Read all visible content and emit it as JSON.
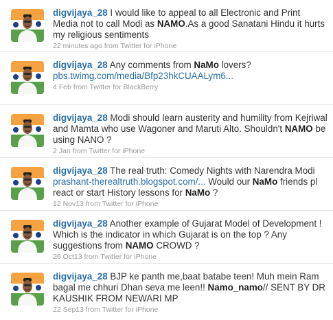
{
  "colors": {
    "link": "#2a6fa8",
    "text": "#333333",
    "meta": "#999999",
    "divider": "#e6e6e6"
  },
  "avatar": {
    "icon": "profile-photo"
  },
  "tweets": [
    {
      "user": "digvijaya_28",
      "parts": [
        {
          "t": " I would like to appeal to all Electronic and Print Media not to call Modi as "
        },
        {
          "t": "NAMO",
          "b": true
        },
        {
          "t": ".As a good Sanatani Hindu it hurts my religious sentiments"
        }
      ],
      "time": "22 minutes ago",
      "source": "from Twitter for iPhone"
    },
    {
      "user": "digvijaya_28",
      "parts": [
        {
          "t": " Any comments from "
        },
        {
          "t": "NaMo",
          "b": true
        },
        {
          "t": " lovers? "
        },
        {
          "t": "pbs.twimg.com/media/Bfp23hkCUAALym6...",
          "l": true
        }
      ],
      "time": "4 Feb",
      "source": "from Twitter for BlackBerry"
    },
    {
      "user": "digvijaya_28",
      "parts": [
        {
          "t": " Modi should learn austerity and humility from Kejriwal and Mamta who use Wagoner and Maruti Alto. Shouldn't "
        },
        {
          "t": "NAMO",
          "b": true
        },
        {
          "t": " be using NANO ?"
        }
      ],
      "time": "2 Jan",
      "source": "from Twitter for iPhone"
    },
    {
      "user": "digvijaya_28",
      "parts": [
        {
          "t": " The real truth: Comedy Nights with Narendra Modi "
        },
        {
          "t": "prashant-therealtruth.blogspot.com/...",
          "l": true
        },
        {
          "t": " Would our "
        },
        {
          "t": "NaMo",
          "b": true
        },
        {
          "t": " friends pl react or start History lessons for "
        },
        {
          "t": "NaMo",
          "b": true
        },
        {
          "t": " ?"
        }
      ],
      "time": "12 Nov13",
      "source": "from Twitter for iPhone"
    },
    {
      "user": "digvijaya_28",
      "parts": [
        {
          "t": " Another example of Gujarat Model of Development ! Which is the indicator in which Gujarat is on the top ? Any suggestions from "
        },
        {
          "t": "NAMO",
          "b": true
        },
        {
          "t": " CROWD ?"
        }
      ],
      "time": "26 Oct13",
      "source": "from Twitter for iPhone"
    },
    {
      "user": "digvijaya_28",
      "parts": [
        {
          "t": " BJP ke panth me,baat batabe teen! Muh mein Ram bagal me chhuri Dhan seva me leen!! "
        },
        {
          "t": "Namo_namo",
          "b": true
        },
        {
          "t": "// SENT BY DR KAUSHIK FROM NEWARI MP"
        }
      ],
      "time": "22 Sep13",
      "source": "from Twitter for iPhone"
    }
  ]
}
